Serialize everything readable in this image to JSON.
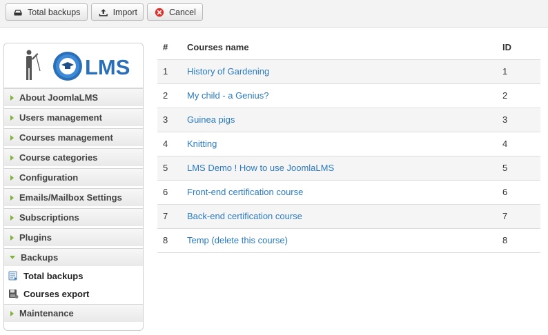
{
  "toolbar": {
    "total_backups_label": "Total backups",
    "import_label": "Import",
    "cancel_label": "Cancel"
  },
  "logo": {
    "text": "LMS"
  },
  "sidebar": {
    "items": [
      {
        "label": "About JoomlaLMS"
      },
      {
        "label": "Users management"
      },
      {
        "label": "Courses management"
      },
      {
        "label": "Course categories"
      },
      {
        "label": "Configuration"
      },
      {
        "label": "Emails/Mailbox Settings"
      },
      {
        "label": "Subscriptions"
      },
      {
        "label": "Plugins"
      },
      {
        "label": "Backups",
        "expanded": true
      },
      {
        "label": "Maintenance"
      }
    ],
    "backups_sub": [
      {
        "label": "Total backups"
      },
      {
        "label": "Courses export"
      }
    ]
  },
  "table": {
    "headers": {
      "num": "#",
      "name": "Courses name",
      "id": "ID"
    },
    "rows": [
      {
        "num": "1",
        "name": "History of Gardening",
        "id": "1"
      },
      {
        "num": "2",
        "name": "My child - a Genius?",
        "id": "2"
      },
      {
        "num": "3",
        "name": "Guinea pigs",
        "id": "3"
      },
      {
        "num": "4",
        "name": "Knitting",
        "id": "4"
      },
      {
        "num": "5",
        "name": "LMS Demo ! How to use JoomlaLMS",
        "id": "5"
      },
      {
        "num": "6",
        "name": "Front-end certification course",
        "id": "6"
      },
      {
        "num": "7",
        "name": "Back-end certification course",
        "id": "7"
      },
      {
        "num": "8",
        "name": "Temp (delete this course)",
        "id": "8"
      }
    ]
  },
  "colors": {
    "link": "#2a7ac1",
    "accent_arrow": "#7fb33a",
    "cancel_red": "#d9322b"
  }
}
